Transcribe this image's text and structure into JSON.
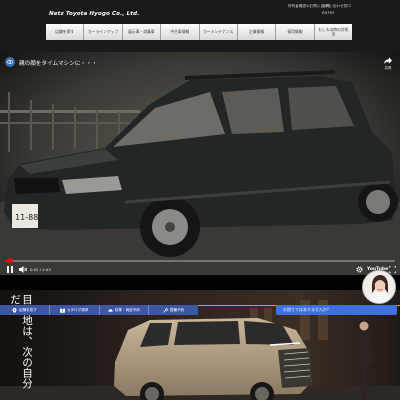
{
  "header": {
    "brand": "Netz Toyota Hyogo Co., Ltd.",
    "util_links": [
      "所有者確認のお問い合わせ",
      "お問い合わせ窓口",
      "ENTRY"
    ]
  },
  "nav": {
    "items": [
      "店舗を探す",
      "カーラインアップ",
      "展示車・試乗車",
      "中古車情報",
      "カーメンテナンス",
      "企業情報",
      "採用情報",
      "もしもの時の対処法"
    ]
  },
  "video": {
    "title": "親の顔をタイムマシンに・・・",
    "share_label": "共有",
    "current_time": "0:02",
    "duration": "2:43",
    "progress": 0.013,
    "platform": "YouTube"
  },
  "banner": {
    "copy": "目的地は、次の自分だ。"
  },
  "tools": {
    "items": [
      {
        "label": "店舗を探す",
        "icon": "pin-icon"
      },
      {
        "label": "カタログ請求",
        "icon": "book-icon"
      },
      {
        "label": "試乗・商談予約",
        "icon": "car-icon"
      },
      {
        "label": "整備予約",
        "icon": "wrench-icon"
      }
    ]
  },
  "chat": {
    "text": "お困りではありませんか？"
  },
  "colors": {
    "accent_blue": "#3c57a5",
    "chat_blue": "#3f6fe0",
    "progress_red": "#ff0000",
    "orange_line": "#f39800"
  }
}
